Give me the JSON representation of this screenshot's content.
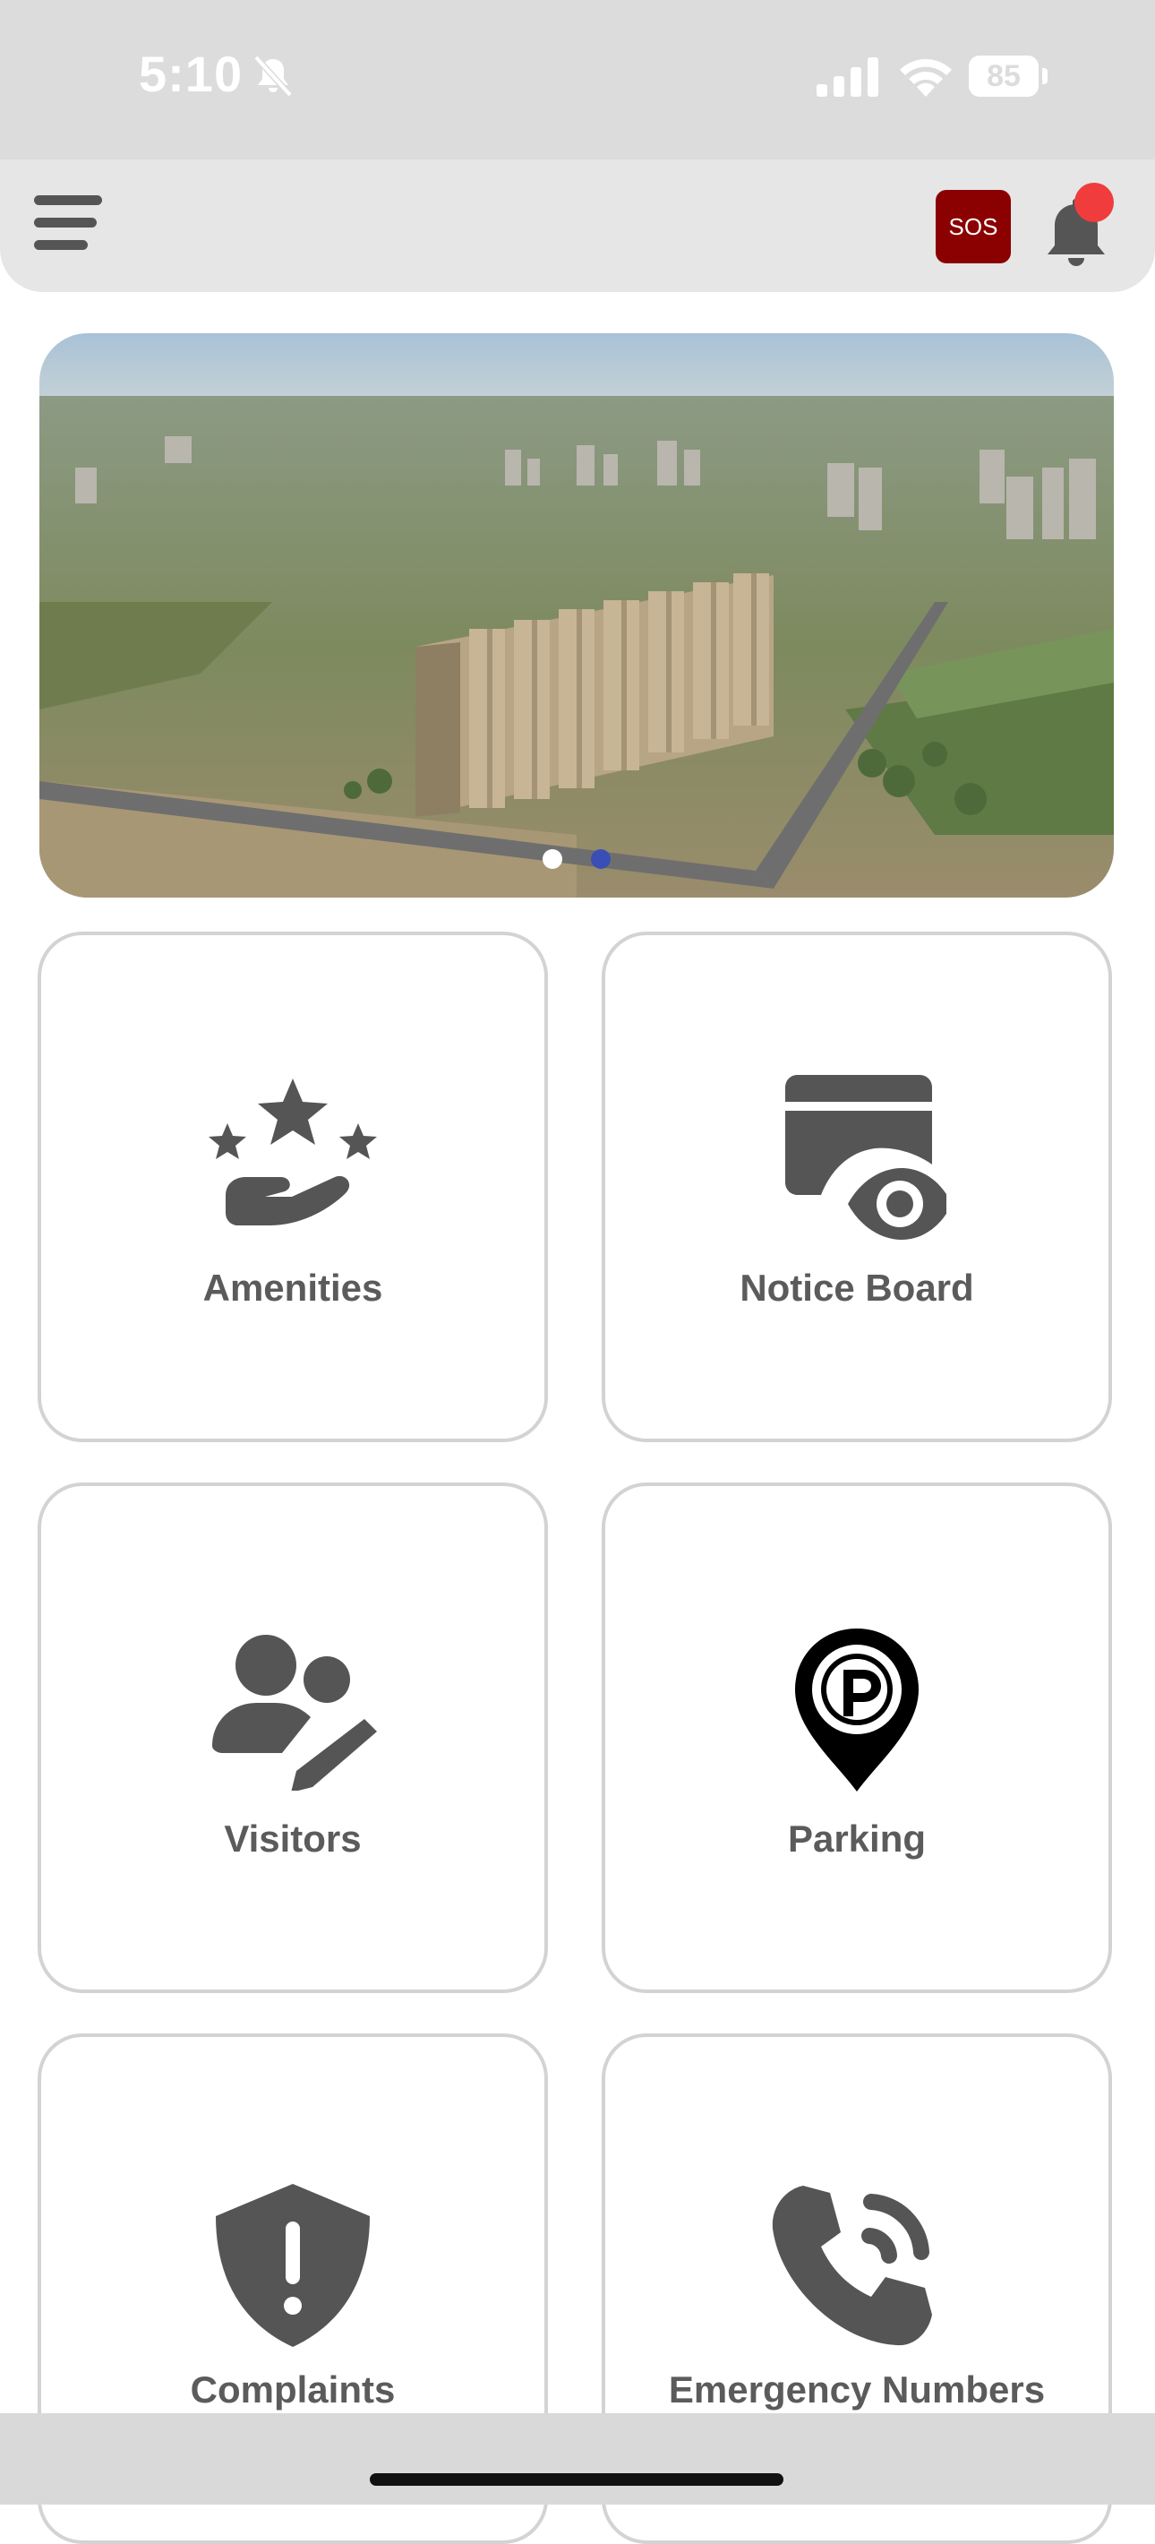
{
  "status_bar": {
    "time": "5:10",
    "battery": "85",
    "icons": [
      "bell-slash-icon",
      "signal-icon",
      "wifi-icon",
      "battery-icon"
    ]
  },
  "header": {
    "menu_icon": "hamburger-menu-icon",
    "sos_label": "SOS",
    "notification_icon": "bell-icon"
  },
  "banner": {
    "slide_count": 2,
    "active_slide": 2,
    "dot_colors": {
      "inactive": "#ffffff",
      "active": "#3a4fb5"
    }
  },
  "tiles": [
    {
      "label": "Amenities",
      "icon": "hand-stars-icon"
    },
    {
      "label": "Notice Board",
      "icon": "window-eye-icon"
    },
    {
      "label": "Visitors",
      "icon": "users-pen-icon"
    },
    {
      "label": "Parking",
      "icon": "parking-pin-icon"
    },
    {
      "label": "Complaints",
      "icon": "shield-exclamation-icon"
    },
    {
      "label": "Emergency Numbers",
      "icon": "phone-volume-icon"
    }
  ],
  "colors": {
    "sos": "#8b0000",
    "notification_badge": "#f03c3c",
    "tile_text": "#5b5b5b",
    "icon": "#555555"
  }
}
